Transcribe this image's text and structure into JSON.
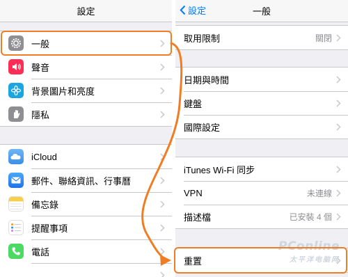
{
  "left_pane": {
    "title": "設定",
    "groups": [
      [
        {
          "label": "一般",
          "icon": "gear-icon",
          "color": "#8e8e93"
        },
        {
          "label": "聲音",
          "icon": "speaker-icon",
          "color": "#ff2d55"
        },
        {
          "label": "背景圖片和亮度",
          "icon": "flower-icon",
          "color": "#1aa6e0"
        },
        {
          "label": "隱私",
          "icon": "hand-icon",
          "color": "#8e8e93"
        }
      ],
      [
        {
          "label": "iCloud",
          "icon": "cloud-icon",
          "color": "#3b8de8"
        },
        {
          "label": "郵件、聯絡資訊、行事曆",
          "icon": "mail-icon",
          "color": "#1f88f0"
        },
        {
          "label": "備忘錄",
          "icon": "notes-icon",
          "color": "#f8d047"
        },
        {
          "label": "提醒事項",
          "icon": "reminders-icon",
          "color": "#ffffff"
        },
        {
          "label": "電話",
          "icon": "phone-icon",
          "color": "#4cd964"
        }
      ]
    ]
  },
  "right_pane": {
    "back_label": "設定",
    "title": "一般",
    "groups": [
      [
        {
          "label": "取用限制",
          "value": "關閉"
        }
      ],
      [
        {
          "label": "日期與時間",
          "value": ""
        },
        {
          "label": "鍵盤",
          "value": ""
        },
        {
          "label": "國際設定",
          "value": ""
        }
      ],
      [
        {
          "label": "iTunes Wi-Fi 同步",
          "value": ""
        },
        {
          "label": "VPN",
          "value": "未連線"
        },
        {
          "label": "描述檔",
          "value": "已安裝 4 個"
        }
      ],
      [
        {
          "label": "重置",
          "value": ""
        }
      ]
    ]
  },
  "annotation": {
    "color": "#f07d23"
  },
  "watermark": {
    "line1": "PConline",
    "line2": "太平洋电脑网"
  }
}
